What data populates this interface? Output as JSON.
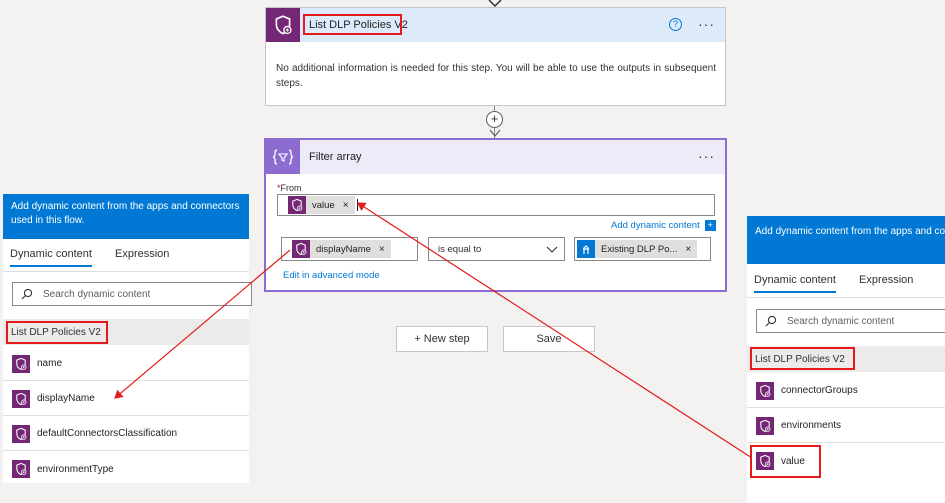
{
  "list_step": {
    "title": "List DLP Policies V2",
    "help": "?",
    "more": "···",
    "message": "No additional information is needed for this step. You will be able to use the outputs in subsequent steps."
  },
  "insert": {
    "plus": "+"
  },
  "filter_step": {
    "title": "Filter array",
    "more": "···",
    "from_label": "From",
    "required_mark": "*",
    "from_token": "value",
    "add_dynamic": "Add dynamic content",
    "add_dynamic_plus": "+",
    "left_token": "displayName",
    "operator": "is equal to",
    "right_token": "Existing DLP Po...",
    "advanced": "Edit in advanced mode",
    "remove": "×"
  },
  "actions": {
    "new_step": "+ New step",
    "save": "Save"
  },
  "left_panel": {
    "banner": "Add dynamic content from the apps and connectors used in this flow.",
    "tab_dynamic": "Dynamic content",
    "tab_expression": "Expression",
    "search_placeholder": "Search dynamic content",
    "section": "List DLP Policies V2",
    "items": [
      "name",
      "displayName",
      "defaultConnectorsClassification",
      "environmentType"
    ]
  },
  "right_panel": {
    "banner": "Add dynamic content from the apps and co used in this flow.",
    "tab_dynamic": "Dynamic content",
    "tab_expression": "Expression",
    "search_placeholder": "Search dynamic content",
    "section": "List DLP Policies V2",
    "items": [
      "connectorGroups",
      "environments",
      "value"
    ]
  },
  "colors": {
    "connector": "#742774",
    "filter": "#8c6cd1",
    "accent": "#0078d4",
    "highlight": "#e31b1b"
  }
}
